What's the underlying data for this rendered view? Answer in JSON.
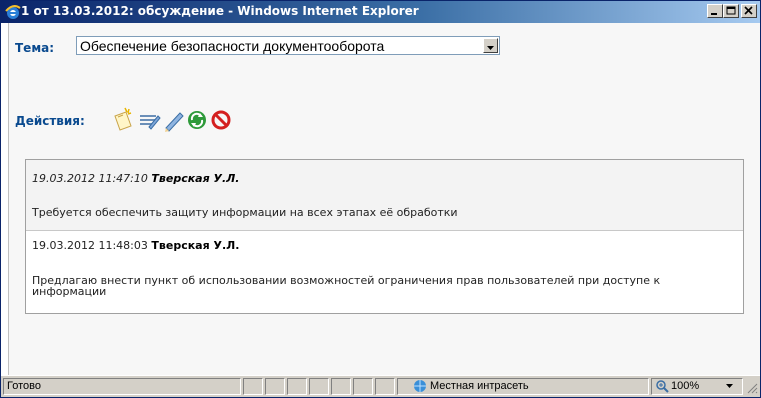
{
  "window": {
    "title": "1 от 13.03.2012: обсуждение - Windows Internet Explorer"
  },
  "form": {
    "topic_label": "Тема:",
    "topic_value": "Обеспечение безопасности документооборота",
    "actions_label": "Действия:"
  },
  "actions": [
    {
      "name": "new-message-icon"
    },
    {
      "name": "edit-list-icon"
    },
    {
      "name": "pencil-icon"
    },
    {
      "name": "refresh-icon"
    },
    {
      "name": "delete-icon"
    }
  ],
  "messages": [
    {
      "timestamp": "19.03.2012 11:47:10",
      "author": "Тверская У.Л.",
      "text": "Требуется обеспечить защиту информации на всех этапах её обработки"
    },
    {
      "timestamp": "19.03.2012 11:48:03",
      "author": "Тверская У.Л.",
      "text": "Предлагаю внести пункт об использовании возможностей ограничения прав пользователей при доступе к информации"
    }
  ],
  "statusbar": {
    "status": "Готово",
    "zone": "Местная интрасеть",
    "zoom": "100%"
  }
}
